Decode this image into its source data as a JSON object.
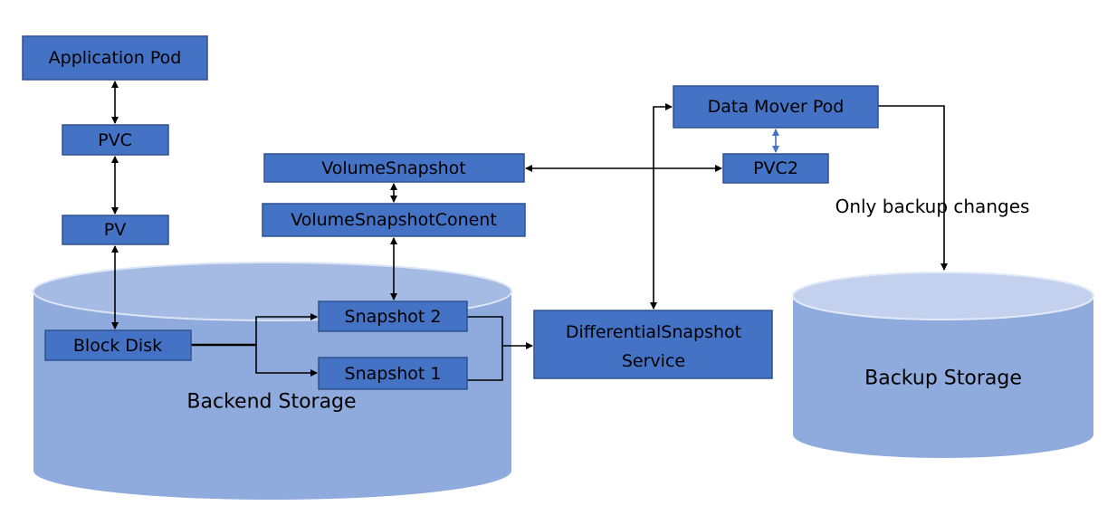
{
  "nodes": {
    "application_pod": "Application Pod",
    "pvc": "PVC",
    "pv": "PV",
    "block_disk": "Block Disk",
    "volume_snapshot": "VolumeSnapshot",
    "volume_snapshot_content": "VolumeSnapshotConent",
    "snapshot2": "Snapshot 2",
    "snapshot1": "Snapshot 1",
    "diff_service_line1": "DifferentialSnapshot",
    "diff_service_line2": "Service",
    "data_mover_pod": "Data Mover Pod",
    "pvc2": "PVC2"
  },
  "storage": {
    "backend": "Backend Storage",
    "backup": "Backup Storage"
  },
  "annotations": {
    "only_backup_changes": "Only backup changes"
  },
  "colors": {
    "box_fill": "#4472C4",
    "box_border": "#2F528F",
    "cylinder_body": "#8FAADC",
    "cylinder_top": "#B4C7E7",
    "pvc2_link": "#4472C4"
  }
}
